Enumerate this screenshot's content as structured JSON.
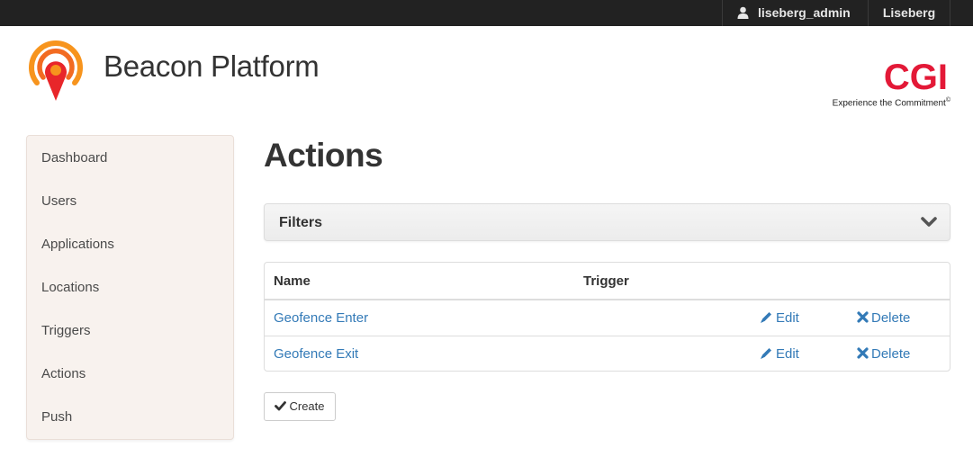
{
  "topbar": {
    "username": "liseberg_admin",
    "tenant": "Liseberg"
  },
  "brand": {
    "title": "Beacon Platform",
    "logo_icon": "beacon-location-pin-icon"
  },
  "partner": {
    "logo_text": "CGI",
    "tagline": "Experience the Commitment",
    "tagline_mark": "©"
  },
  "sidebar": {
    "items": [
      {
        "label": "Dashboard"
      },
      {
        "label": "Users"
      },
      {
        "label": "Applications"
      },
      {
        "label": "Locations"
      },
      {
        "label": "Triggers"
      },
      {
        "label": "Actions"
      },
      {
        "label": "Push"
      }
    ]
  },
  "main": {
    "title": "Actions",
    "filters": {
      "title": "Filters",
      "toggle_icon": "chevron-down-icon"
    },
    "table": {
      "columns": [
        "Name",
        "Trigger"
      ],
      "rows": [
        {
          "name": "Geofence Enter",
          "trigger": "",
          "edit_label": "Edit",
          "delete_label": "Delete"
        },
        {
          "name": "Geofence Exit",
          "trigger": "",
          "edit_label": "Edit",
          "delete_label": "Delete"
        }
      ]
    },
    "create_label": "Create"
  },
  "colors": {
    "topbar": "#222222",
    "link": "#337ab7",
    "sidebar_bg": "#f8f2ee",
    "brand_orange": "#f26b22",
    "cgi_red": "#e31937"
  }
}
